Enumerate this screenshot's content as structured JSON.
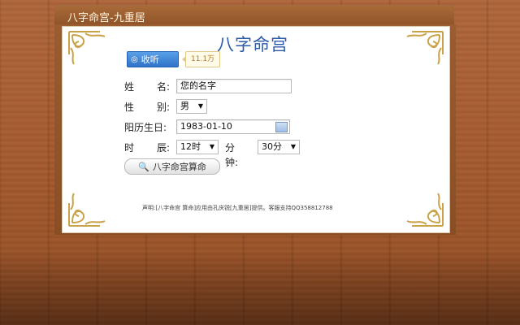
{
  "window": {
    "title": "八字命宫-九重居"
  },
  "app": {
    "title": "八字命宫"
  },
  "favorite": {
    "label": "收听",
    "count": "11.1万",
    "icon": "weibo-icon"
  },
  "form": {
    "name": {
      "label": "姓　名:",
      "label_chars": [
        "姓",
        "名:"
      ],
      "value": "您的名字"
    },
    "gender": {
      "label_chars": [
        "性",
        "别:"
      ],
      "value": "男"
    },
    "birthday": {
      "label": "阳历生日:",
      "value": "1983-01-10"
    },
    "hour": {
      "label_chars": [
        "时",
        "辰:"
      ],
      "value": "12时"
    },
    "minute": {
      "label": "分钟:",
      "value": "30分"
    }
  },
  "submit": {
    "label": "八字命宫算命",
    "icon": "search-icon"
  },
  "footer": {
    "note": "声明:[八字命宫 算命]应用由孔庆锐[九重居]提供。客服支持QQ358812788"
  },
  "colors": {
    "accent": "#2a5aa8",
    "frame": "#9a5c30",
    "button": "#2f72c8"
  }
}
